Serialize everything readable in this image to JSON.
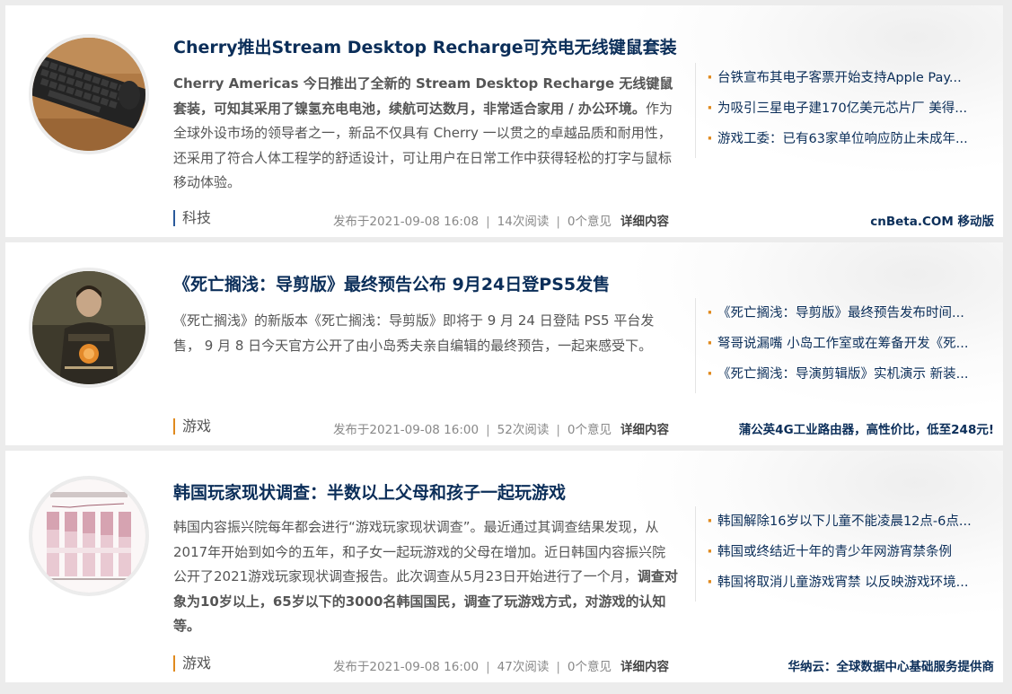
{
  "articles": [
    {
      "title": "Cherry推出Stream Desktop Recharge可充电无线键鼠套装",
      "summary_bold": "Cherry Americas 今日推出了全新的 Stream Desktop Recharge 无线键鼠套装，可知其采用了镍氢充电电池，续航可达数月，非常适合家用 / 办公环境。",
      "summary_rest": "作为全球外设市场的领导者之一，新品不仅具有 Cherry 一以贯之的卓越品质和耐用性，还采用了符合人体工程学的舒适设计，可让用户在日常工作中获得轻松的打字与鼠标移动体验。",
      "category": "科技",
      "date": "发布于2021-09-08 16:08",
      "reads": "14次阅读",
      "comments": "0个意见",
      "more": "详细内容",
      "related": [
        "台铁宣布其电子客票开始支持Apple Pay...",
        "为吸引三星电子建170亿美元芯片厂 美得...",
        "游戏工委：已有63家单位响应防止未成年..."
      ],
      "promo": "cnBeta.COM 移动版"
    },
    {
      "title": "《死亡搁浅：导剪版》最终预告公布 9月24日登PS5发售",
      "summary_plain": "《死亡搁浅》的新版本《死亡搁浅：导剪版》即将于 9 月 24 日登陆 PS5 平台发售， 9 月 8 日今天官方公开了由小岛秀夫亲自编辑的最终预告，一起来感受下。",
      "category": "游戏",
      "date": "发布于2021-09-08 16:00",
      "reads": "52次阅读",
      "comments": "0个意见",
      "more": "详细内容",
      "related": [
        "《死亡搁浅：导剪版》最终预告发布时间...",
        "弩哥说漏嘴 小岛工作室或在筹备开发《死...",
        "《死亡搁浅：导演剪辑版》实机演示 新装..."
      ],
      "promo": "蒲公英4G工业路由器，高性价比，低至248元!"
    },
    {
      "title": "韩国玩家现状调查：半数以上父母和孩子一起玩游戏",
      "summary_plain": "韩国内容振兴院每年都会进行“游戏玩家现状调查”。最近通过其调查结果发现，从2017年开始到如今的五年，和子女一起玩游戏的父母在增加。近日韩国内容振兴院公开了2021游戏玩家现状调查报告。此次调查从5月23日开始进行了一个月，",
      "summary_bold": "调查对象为10岁以上，65岁以下的3000名韩国国民，调查了玩游戏方式，对游戏的认知等。",
      "category": "游戏",
      "date": "发布于2021-09-08 16:00",
      "reads": "47次阅读",
      "comments": "0个意见",
      "more": "详细内容",
      "related": [
        "韩国解除16岁以下儿童不能凌晨12点-6点...",
        "韩国或终结近十年的青少年网游宵禁条例",
        "韩国将取消儿童游戏宵禁 以反映游戏环境..."
      ],
      "promo": "华纳云：全球数据中心基础服务提供商"
    }
  ],
  "sep": "|",
  "colors": {
    "title": "#0b2e59",
    "accent_blue": "#2a5a9b",
    "accent_orange": "#e08a1e"
  }
}
